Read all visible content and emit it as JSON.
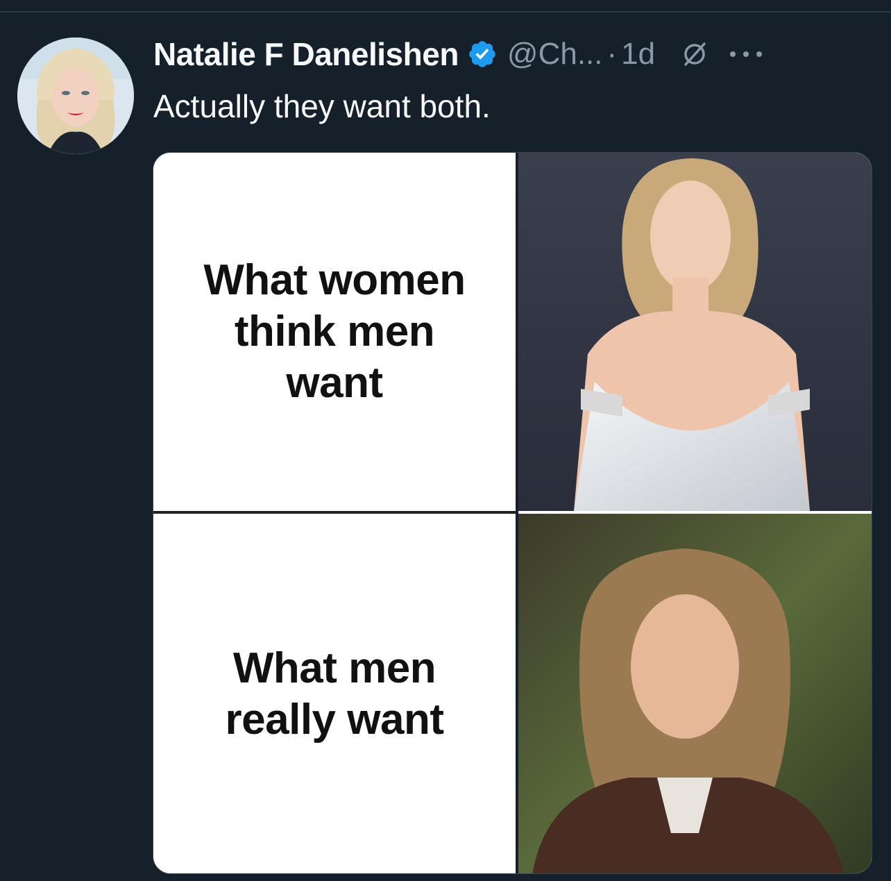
{
  "tweet": {
    "display_name": "Natalie F Danelishen",
    "handle": "@Ch...",
    "separator": "·",
    "timestamp": "1d",
    "text": "Actually they want both."
  },
  "meme": {
    "top_caption": "What women\nthink men\nwant",
    "bottom_caption": "What men\nreally want"
  },
  "icons": {
    "verified": "verified-badge-icon",
    "no_reply": "no-reply-icon",
    "more": "more-options-icon"
  },
  "colors": {
    "background": "#15202b",
    "verified_blue": "#1d9bf0",
    "primary_text": "#f7f9f9",
    "secondary_text": "#8b98a5"
  }
}
